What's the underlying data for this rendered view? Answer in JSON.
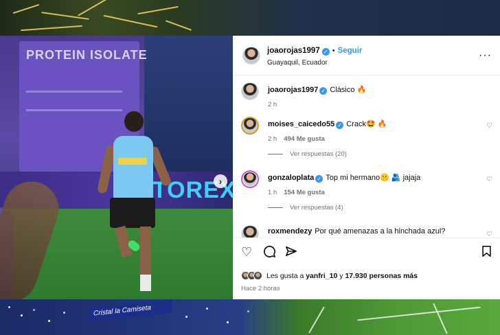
{
  "post": {
    "author": "joaorojas1997",
    "follow_label": "Seguir",
    "location": "Guayaquil, Ecuador",
    "caption": {
      "user": "joaorojas1997",
      "text": "Clásico 🔥",
      "time": "2 h"
    },
    "media": {
      "billboard_text": "PROTEIN ISOLATE",
      "ad_text": "TOREX",
      "next_icon": "chevron-right-icon"
    },
    "comments": [
      {
        "user": "moises_caicedo55",
        "text": "Crack🤩 🔥",
        "time": "2 h",
        "likes": "494 Me gusta",
        "replies": "Ver respuestas (20)"
      },
      {
        "user": "gonzaloplata",
        "text": "Top mi hermano🤫 🫂 jajaja",
        "time": "1 h",
        "likes": "154 Me gusta",
        "replies": "Ver respuestas (4)"
      },
      {
        "user": "roxmendezy",
        "text": "Por qué amenazas a la hinchada azul?"
      }
    ],
    "actions": {
      "like_icon": "heart-icon",
      "comment_icon": "comment-icon",
      "share_icon": "send-icon",
      "save_icon": "bookmark-icon"
    },
    "likes_summary": {
      "prefix": "Les gusta a",
      "user": "yanfri_10",
      "connector": "y",
      "others": "17.930 personas más"
    },
    "time_ago": "Hace 2 horas"
  },
  "background": {
    "banner_text": "Cristal la Camiseta"
  },
  "colors": {
    "link_blue": "#3897f0",
    "secondary_text": "#737373"
  }
}
